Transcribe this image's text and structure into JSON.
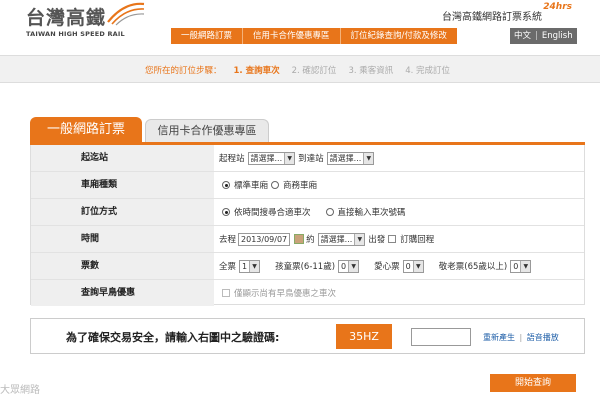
{
  "header": {
    "logo_cn": "台灣高鐵",
    "logo_en": "TAIWAN HIGH SPEED RAIL",
    "system_title": "台灣高鐵網路訂票系統",
    "badge_24": "24hrs",
    "nav": [
      "一般網路訂票",
      "信用卡合作優惠專區",
      "訂位紀錄查詢/付款及修改"
    ],
    "lang_zh": "中文",
    "lang_sep": "|",
    "lang_en": "English"
  },
  "steps": {
    "lead": "您所在的訂位步驟：",
    "items": [
      "1. 查詢車次",
      "2. 確認訂位",
      "3. 乘客資訊",
      "4. 完成訂位"
    ]
  },
  "tabs": {
    "active": "一般網路訂票",
    "inactive": "信用卡合作優惠專區"
  },
  "form": {
    "station": {
      "label": "起迄站",
      "from_text": "起程站",
      "from_value": "請選擇...",
      "to_text": "到達站",
      "to_value": "請選擇..."
    },
    "car_type": {
      "label": "車廂種類",
      "opt1": "標準車廂",
      "opt2": "商務車廂"
    },
    "method": {
      "label": "訂位方式",
      "opt1": "依時間搜尋合適車次",
      "opt2": "直接輸入車次號碼"
    },
    "time": {
      "label": "時間",
      "go_text": "去程",
      "date": "2013/09/07",
      "about_text": "約",
      "time_value": "請選擇...",
      "depart_text": "出發",
      "return_text": "訂購回程"
    },
    "tickets": {
      "label": "票數",
      "full_text": "全票",
      "full_value": "1",
      "child_text": "孩童票(6-11歲)",
      "child_value": "0",
      "love_text": "愛心票",
      "love_value": "0",
      "senior_text": "敬老票(65歲以上)",
      "senior_value": "0"
    },
    "early": {
      "label": "查詢早鳥優惠",
      "opt": "僅顯示尚有早鳥優惠之車次"
    }
  },
  "captcha": {
    "label": "為了確保交易安全，請輸入右圖中之驗證碼:",
    "code": "35HZ",
    "regen": "重新產生",
    "sep": "|",
    "audio": "語音播放"
  },
  "watermark": "大眾網路",
  "submit": "開始查詢",
  "colors": {
    "accent": "#e8751a",
    "label_bg": "#efefef"
  }
}
